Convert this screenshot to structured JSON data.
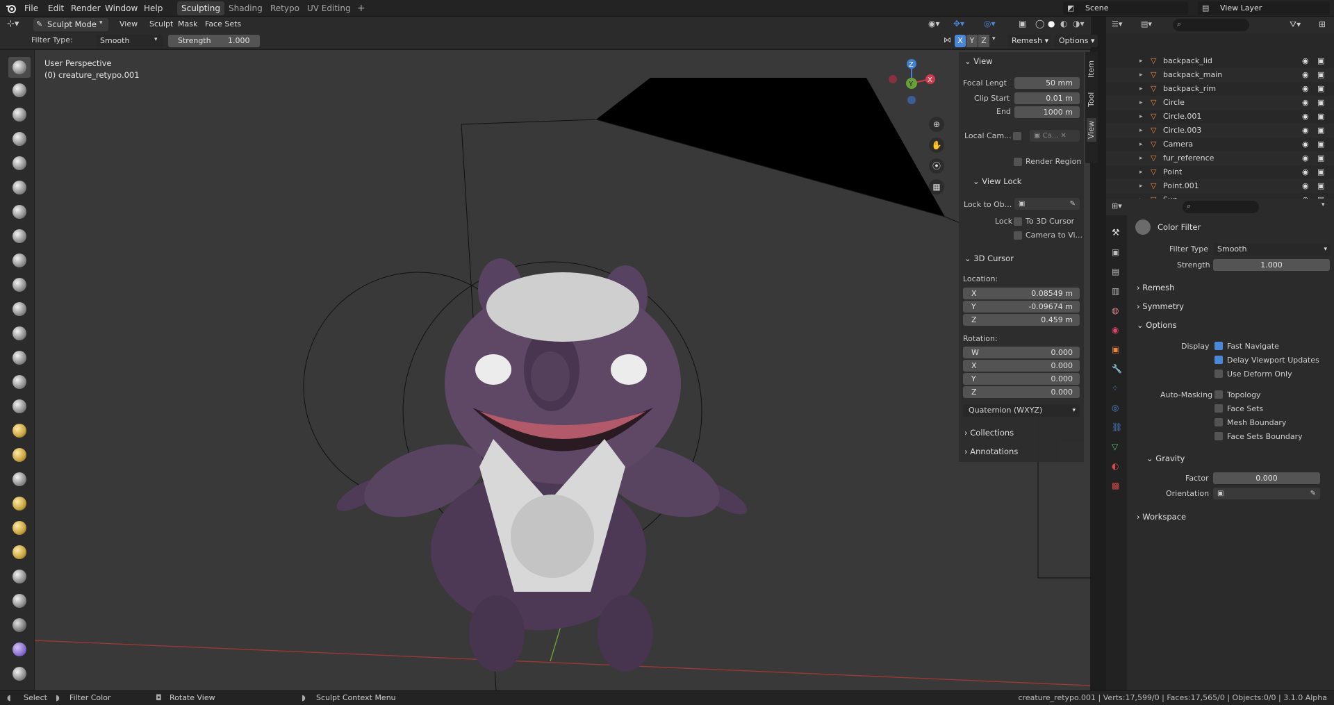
{
  "topbar": {
    "menus": [
      "File",
      "Edit",
      "Render",
      "Window",
      "Help"
    ],
    "workspaces": [
      "Sculpting",
      "Shading",
      "Retypo",
      "UV Editing"
    ],
    "add_workspace": "+",
    "scene": "Scene",
    "view_layer": "View Layer"
  },
  "header": {
    "mode": "Sculpt Mode",
    "menus": [
      "View",
      "Sculpt",
      "Mask",
      "Face Sets"
    ],
    "filter_type_label": "Filter Type:",
    "filter_type_value": "Smooth",
    "strength_label": "Strength",
    "strength_value": "1.000",
    "axes": [
      "X",
      "Y",
      "Z"
    ],
    "remesh": "Remesh",
    "options": "Options"
  },
  "viewport": {
    "perspective": "User Perspective",
    "object": "(0) creature_retypo.001",
    "gizmo_axes": [
      "Z",
      "X",
      "Y"
    ]
  },
  "npanel": {
    "tabs": [
      "Item",
      "Tool",
      "View"
    ],
    "view_header": "View",
    "focal_length_label": "Focal Lengt",
    "focal_length": "50 mm",
    "clip_start_label": "Clip Start",
    "clip_start": "0.01 m",
    "end_label": "End",
    "end": "1000 m",
    "local_camera_label": "Local Cam...",
    "local_camera_value": "Ca...",
    "render_region": "Render Region",
    "view_lock_header": "View Lock",
    "lock_to_obj_label": "Lock to Ob...",
    "lock_label": "Lock",
    "to_3d_cursor": "To 3D Cursor",
    "camera_to_view": "Camera to Vi...",
    "cursor_header": "3D Cursor",
    "location_label": "Location:",
    "loc": [
      {
        "axis": "X",
        "value": "0.08549 m"
      },
      {
        "axis": "Y",
        "value": "-0.09674 m"
      },
      {
        "axis": "Z",
        "value": "0.459 m"
      }
    ],
    "rotation_label": "Rotation:",
    "rot": [
      {
        "axis": "W",
        "value": "0.000"
      },
      {
        "axis": "X",
        "value": "0.000"
      },
      {
        "axis": "Y",
        "value": "0.000"
      },
      {
        "axis": "Z",
        "value": "0.000"
      }
    ],
    "rotation_mode": "Quaternion (WXYZ)",
    "collections": "Collections",
    "annotations": "Annotations"
  },
  "outliner": {
    "rows": [
      {
        "name": "backpack_lid"
      },
      {
        "name": "backpack_main"
      },
      {
        "name": "backpack_rim"
      },
      {
        "name": "Circle"
      },
      {
        "name": "Circle.001"
      },
      {
        "name": "Circle.003"
      },
      {
        "name": "Camera"
      },
      {
        "name": "fur_reference"
      },
      {
        "name": "Point"
      },
      {
        "name": "Point.001"
      },
      {
        "name": "Sun"
      }
    ]
  },
  "properties": {
    "title": "Color Filter",
    "filter_type_label": "Filter Type",
    "filter_type": "Smooth",
    "strength_label": "Strength",
    "strength": "1.000",
    "remesh": "Remesh",
    "symmetry": "Symmetry",
    "options": "Options",
    "display_label": "Display",
    "fast_navigate": "Fast Navigate",
    "delay_updates": "Delay Viewport Updates",
    "use_deform_only": "Use Deform Only",
    "automasking_label": "Auto-Masking",
    "topology": "Topology",
    "face_sets": "Face Sets",
    "mesh_boundary": "Mesh Boundary",
    "face_sets_boundary": "Face Sets Boundary",
    "gravity": "Gravity",
    "factor_label": "Factor",
    "factor": "0.000",
    "orientation_label": "Orientation",
    "workspace": "Workspace"
  },
  "statusbar": {
    "select": "Select",
    "filter_color": "Filter Color",
    "rotate_view": "Rotate View",
    "context_menu": "Sculpt Context Menu",
    "stats": "creature_retypo.001 | Verts:17,599/0 | Faces:17,565/0 | Objects:0/0 | 3.1.0 Alpha"
  },
  "colors": {
    "accent": "#4a87d6",
    "selected_tab": "#3a3a3a",
    "creature": "#5e4866"
  }
}
